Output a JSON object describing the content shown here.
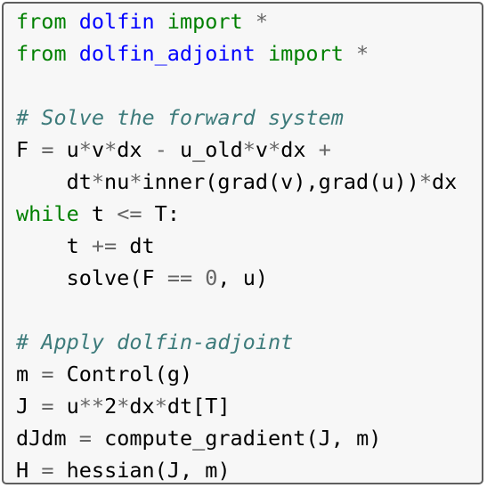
{
  "code_block": {
    "lines": [
      [
        {
          "t": "from",
          "c": "kw"
        },
        {
          "t": " ",
          "c": "sp"
        },
        {
          "t": "dolfin",
          "c": "ns"
        },
        {
          "t": " ",
          "c": "sp"
        },
        {
          "t": "import",
          "c": "kw"
        },
        {
          "t": " ",
          "c": "sp"
        },
        {
          "t": "*",
          "c": "op"
        }
      ],
      [
        {
          "t": "from",
          "c": "kw"
        },
        {
          "t": " ",
          "c": "sp"
        },
        {
          "t": "dolfin_adjoint",
          "c": "ns"
        },
        {
          "t": " ",
          "c": "sp"
        },
        {
          "t": "import",
          "c": "kw"
        },
        {
          "t": " ",
          "c": "sp"
        },
        {
          "t": "*",
          "c": "op"
        }
      ],
      [],
      [
        {
          "t": "# Solve the forward system",
          "c": "cm"
        }
      ],
      [
        {
          "t": "F",
          "c": "id"
        },
        {
          "t": " ",
          "c": "sp"
        },
        {
          "t": "=",
          "c": "op"
        },
        {
          "t": " ",
          "c": "sp"
        },
        {
          "t": "u",
          "c": "id"
        },
        {
          "t": "*",
          "c": "op"
        },
        {
          "t": "v",
          "c": "id"
        },
        {
          "t": "*",
          "c": "op"
        },
        {
          "t": "dx",
          "c": "id"
        },
        {
          "t": " ",
          "c": "sp"
        },
        {
          "t": "-",
          "c": "op"
        },
        {
          "t": " ",
          "c": "sp"
        },
        {
          "t": "u_old",
          "c": "id"
        },
        {
          "t": "*",
          "c": "op"
        },
        {
          "t": "v",
          "c": "id"
        },
        {
          "t": "*",
          "c": "op"
        },
        {
          "t": "dx",
          "c": "id"
        },
        {
          "t": " ",
          "c": "sp"
        },
        {
          "t": "+",
          "c": "op"
        }
      ],
      [
        {
          "t": "    ",
          "c": "sp"
        },
        {
          "t": "dt",
          "c": "id"
        },
        {
          "t": "*",
          "c": "op"
        },
        {
          "t": "nu",
          "c": "id"
        },
        {
          "t": "*",
          "c": "op"
        },
        {
          "t": "inner",
          "c": "id"
        },
        {
          "t": "(",
          "c": "pn"
        },
        {
          "t": "grad",
          "c": "id"
        },
        {
          "t": "(",
          "c": "pn"
        },
        {
          "t": "v",
          "c": "id"
        },
        {
          "t": "),",
          "c": "pn"
        },
        {
          "t": "grad",
          "c": "id"
        },
        {
          "t": "(",
          "c": "pn"
        },
        {
          "t": "u",
          "c": "id"
        },
        {
          "t": "))",
          "c": "pn"
        },
        {
          "t": "*",
          "c": "op"
        },
        {
          "t": "dx",
          "c": "id"
        }
      ],
      [
        {
          "t": "while",
          "c": "kw"
        },
        {
          "t": " ",
          "c": "sp"
        },
        {
          "t": "t",
          "c": "id"
        },
        {
          "t": " ",
          "c": "sp"
        },
        {
          "t": "<=",
          "c": "op"
        },
        {
          "t": " ",
          "c": "sp"
        },
        {
          "t": "T",
          "c": "id"
        },
        {
          "t": ":",
          "c": "pn"
        }
      ],
      [
        {
          "t": "    ",
          "c": "sp"
        },
        {
          "t": "t",
          "c": "id"
        },
        {
          "t": " ",
          "c": "sp"
        },
        {
          "t": "+=",
          "c": "op"
        },
        {
          "t": " ",
          "c": "sp"
        },
        {
          "t": "dt",
          "c": "id"
        }
      ],
      [
        {
          "t": "    ",
          "c": "sp"
        },
        {
          "t": "solve",
          "c": "id"
        },
        {
          "t": "(",
          "c": "pn"
        },
        {
          "t": "F",
          "c": "id"
        },
        {
          "t": " ",
          "c": "sp"
        },
        {
          "t": "==",
          "c": "op"
        },
        {
          "t": " ",
          "c": "sp"
        },
        {
          "t": "0",
          "c": "num"
        },
        {
          "t": ",",
          "c": "pn"
        },
        {
          "t": " ",
          "c": "sp"
        },
        {
          "t": "u",
          "c": "id"
        },
        {
          "t": ")",
          "c": "pn"
        }
      ],
      [],
      [
        {
          "t": "# Apply dolfin-adjoint",
          "c": "cm"
        }
      ],
      [
        {
          "t": "m",
          "c": "id"
        },
        {
          "t": " ",
          "c": "sp"
        },
        {
          "t": "=",
          "c": "op"
        },
        {
          "t": " ",
          "c": "sp"
        },
        {
          "t": "Control",
          "c": "id"
        },
        {
          "t": "(",
          "c": "pn"
        },
        {
          "t": "g",
          "c": "id"
        },
        {
          "t": ")",
          "c": "pn"
        }
      ],
      [
        {
          "t": "J",
          "c": "id"
        },
        {
          "t": " ",
          "c": "sp"
        },
        {
          "t": "=",
          "c": "op"
        },
        {
          "t": " ",
          "c": "sp"
        },
        {
          "t": "u",
          "c": "id"
        },
        {
          "t": "**",
          "c": "op"
        },
        {
          "t": "2",
          "c": "id"
        },
        {
          "t": "*",
          "c": "op"
        },
        {
          "t": "dx",
          "c": "id"
        },
        {
          "t": "*",
          "c": "op"
        },
        {
          "t": "dt",
          "c": "id"
        },
        {
          "t": "[",
          "c": "pn"
        },
        {
          "t": "T",
          "c": "id"
        },
        {
          "t": "]",
          "c": "pn"
        }
      ],
      [
        {
          "t": "dJdm",
          "c": "id"
        },
        {
          "t": " ",
          "c": "sp"
        },
        {
          "t": "=",
          "c": "op"
        },
        {
          "t": " ",
          "c": "sp"
        },
        {
          "t": "compute_gradient",
          "c": "id"
        },
        {
          "t": "(",
          "c": "pn"
        },
        {
          "t": "J",
          "c": "id"
        },
        {
          "t": ",",
          "c": "pn"
        },
        {
          "t": " ",
          "c": "sp"
        },
        {
          "t": "m",
          "c": "id"
        },
        {
          "t": ")",
          "c": "pn"
        }
      ],
      [
        {
          "t": "H",
          "c": "id"
        },
        {
          "t": " ",
          "c": "sp"
        },
        {
          "t": "=",
          "c": "op"
        },
        {
          "t": " ",
          "c": "sp"
        },
        {
          "t": "hessian",
          "c": "id"
        },
        {
          "t": "(",
          "c": "pn"
        },
        {
          "t": "J",
          "c": "id"
        },
        {
          "t": ",",
          "c": "pn"
        },
        {
          "t": " ",
          "c": "sp"
        },
        {
          "t": "m",
          "c": "id"
        },
        {
          "t": ")",
          "c": "pn"
        }
      ]
    ]
  },
  "colors": {
    "keyword": "#008000",
    "namespace": "#0000ff",
    "operator": "#666666",
    "comment": "#3d7b7b",
    "text": "#000000",
    "background": "#f7f7f7",
    "border": "#5e5e5e"
  }
}
